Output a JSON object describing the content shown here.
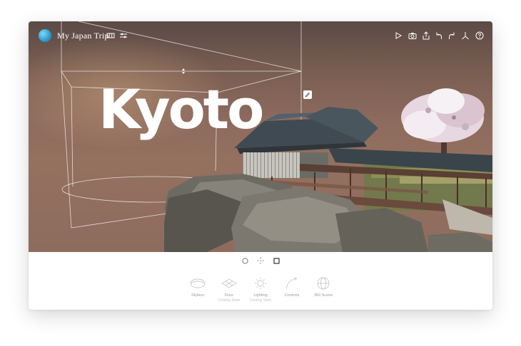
{
  "header": {
    "trip_title": "My Japan Trip"
  },
  "scene": {
    "title_text": "Kyoto"
  },
  "bottom_tools": [
    {
      "label": "Skybox",
      "sublabel": ""
    },
    {
      "label": "Floor",
      "sublabel": "Coming Soon"
    },
    {
      "label": "Lighting",
      "sublabel": "Coming Soon"
    },
    {
      "label": "Controls",
      "sublabel": ""
    },
    {
      "label": "360 Scene",
      "sublabel": ""
    }
  ],
  "colors": {
    "sky_top": "#5b4a46",
    "sky_bottom": "#94705f",
    "logo_blue": "#2a9bd0",
    "tool_label": "#9a9a9a",
    "tool_sublabel": "#c2c2c2"
  },
  "icons": {
    "logo": "globe-logo-icon",
    "map": "map-icon",
    "settings": "sliders-icon",
    "play": "play-icon",
    "camera": "camera-icon",
    "share": "share-icon",
    "undo": "undo-icon",
    "redo": "redo-icon",
    "vr": "compass-icon",
    "help": "help-icon"
  }
}
